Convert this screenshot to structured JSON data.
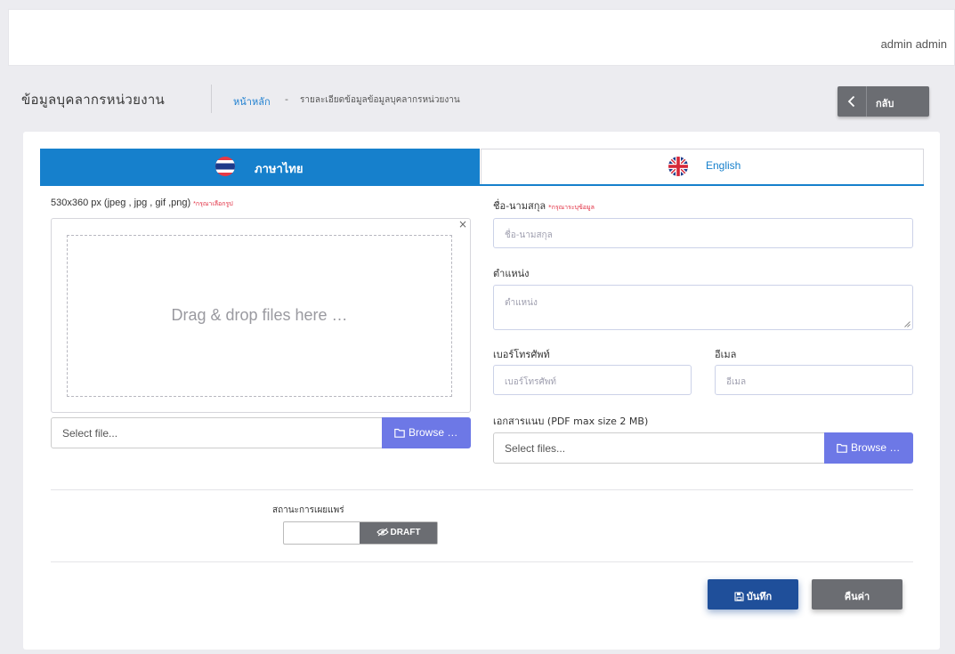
{
  "topbar": {
    "user_name": "admin admin"
  },
  "header": {
    "title": "ข้อมูลบุคลากรหน่วยงาน",
    "breadcrumb": {
      "home": "หน้าหลัก",
      "separator": "-",
      "current": "รายละเอียดข้อมูลข้อมูลบุคลากรหน่วยงาน"
    },
    "back_button": "กลับ"
  },
  "tabs": [
    {
      "label": "ภาษาไทย",
      "flag": "thai-flag-icon",
      "active": true
    },
    {
      "label": "English",
      "flag": "uk-flag-icon",
      "active": false
    }
  ],
  "image_upload": {
    "label": "530x360 px (jpeg , jpg , gif ,png)",
    "required_note": "*กรุณาเลือกรูป",
    "drop_text": "Drag & drop files here …",
    "close_symbol": "×",
    "file_placeholder": "Select file...",
    "browse_label": "Browse …"
  },
  "form": {
    "name": {
      "label": "ชื่อ-นามสกุล",
      "required_note": "*กรุณาระบุข้อมูล",
      "placeholder": "ชื่อ-นามสกุล"
    },
    "position": {
      "label": "ตำแหน่ง",
      "placeholder": "ตำแหน่ง"
    },
    "phone": {
      "label": "เบอร์โทรศัพท์",
      "placeholder": "เบอร์โทรศัพท์"
    },
    "email": {
      "label": "อีเมล",
      "placeholder": "อีเมล"
    },
    "attachment": {
      "label": "เอกสารแนบ (PDF max size 2 MB)",
      "file_placeholder": "Select files...",
      "browse_label": "Browse …"
    }
  },
  "publish": {
    "label": "สถานะการเผยแพร่",
    "state": "DRAFT"
  },
  "actions": {
    "save": "บันทึก",
    "reset": "คืนค่า"
  },
  "colors": {
    "primary": "#1680cc",
    "browse": "#6d78e6",
    "save": "#1f4f9a",
    "neutral": "#6b6d72",
    "required": "#e0283c"
  }
}
